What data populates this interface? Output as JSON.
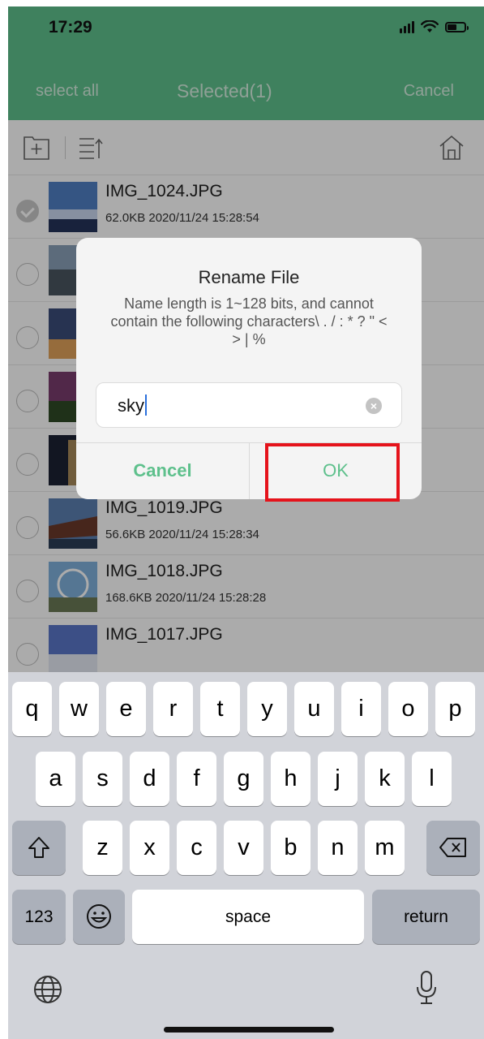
{
  "status": {
    "time": "17:29"
  },
  "nav": {
    "select_all": "select all",
    "title": "Selected(1)",
    "cancel": "Cancel"
  },
  "colors": {
    "accent": "#5ec08c",
    "highlight": "#e5131b"
  },
  "files": [
    {
      "name": "IMG_1024.JPG",
      "meta": "62.0KB 2020/11/24 15:28:54",
      "checked": true
    },
    {
      "name": "",
      "meta": "",
      "checked": false
    },
    {
      "name": "",
      "meta": "",
      "checked": false
    },
    {
      "name": "",
      "meta": "",
      "checked": false
    },
    {
      "name": "",
      "meta": "",
      "checked": false
    },
    {
      "name": "IMG_1019.JPG",
      "meta": "56.6KB 2020/11/24 15:28:34",
      "checked": false
    },
    {
      "name": "IMG_1018.JPG",
      "meta": "168.6KB 2020/11/24 15:28:28",
      "checked": false
    },
    {
      "name": "IMG_1017.JPG",
      "meta": "",
      "checked": false
    }
  ],
  "dialog": {
    "title": "Rename File",
    "message": "Name length is 1~128 bits, and cannot contain the following characters\\ . / : * ? \" < > | %",
    "input_value": "sky",
    "cancel_label": "Cancel",
    "ok_label": "OK"
  },
  "keyboard": {
    "row1": [
      "q",
      "w",
      "e",
      "r",
      "t",
      "y",
      "u",
      "i",
      "o",
      "p"
    ],
    "row2": [
      "a",
      "s",
      "d",
      "f",
      "g",
      "h",
      "j",
      "k",
      "l"
    ],
    "row3": [
      "z",
      "x",
      "c",
      "v",
      "b",
      "n",
      "m"
    ],
    "numbers_label": "123",
    "space_label": "space",
    "return_label": "return"
  },
  "icons": {
    "new_folder": "new-folder-icon",
    "sort": "sort-icon",
    "home": "home-icon",
    "shift": "shift-icon",
    "backspace": "backspace-icon",
    "emoji": "emoji-icon",
    "globe": "globe-icon",
    "mic": "microphone-icon"
  }
}
